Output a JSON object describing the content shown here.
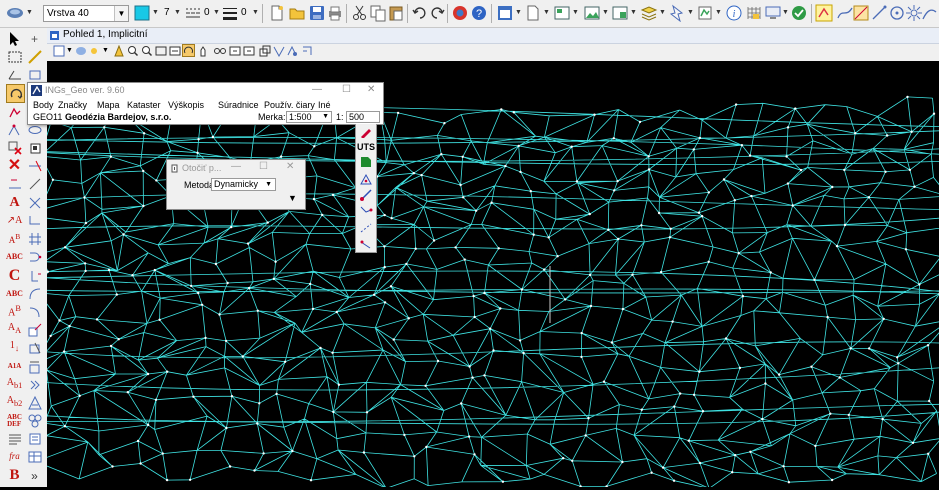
{
  "toolbar": {
    "layer_select": "Vrstva 40",
    "color_value": "7",
    "style_value": "0",
    "weight_value": "0"
  },
  "view": {
    "title": "Pohled 1, Implicitní"
  },
  "ings_window": {
    "title": "INGs_Geo ver. 9.60",
    "menu": [
      "Body",
      "Značky",
      "Mapa",
      "Kataster",
      "Výškopis",
      "Súradnice",
      "Použív. čiary",
      "Iné"
    ],
    "org_code": "GEO11",
    "org_name": "Geodézia Bardejov, s.r.o.",
    "scale_label": "Merka:",
    "scale_select": "1:500",
    "ratio_prefix": "1:",
    "ratio_value": "500"
  },
  "rotate_dialog": {
    "title": "Otočiť p...",
    "method_label": "Metoda:",
    "method_value": "Dynamicky"
  },
  "side_panel": {
    "uts_label": "UTS"
  },
  "colors": {
    "mesh": "#3fe3e3",
    "canvas": "#000000",
    "chrome": "#f0f0f0"
  }
}
